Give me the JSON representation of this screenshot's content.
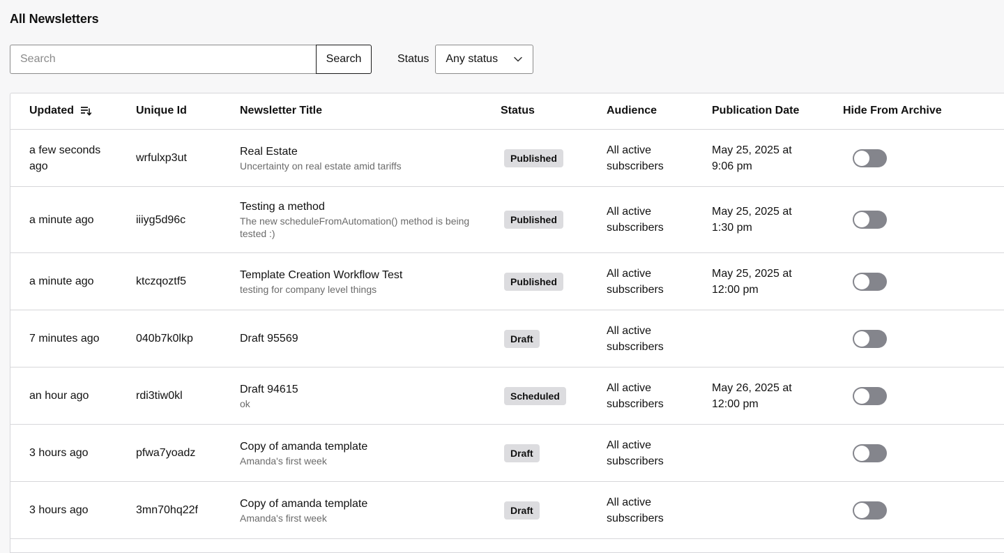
{
  "page": {
    "title": "All Newsletters"
  },
  "search": {
    "placeholder": "Search",
    "value": "",
    "button_label": "Search"
  },
  "status_filter": {
    "label": "Status",
    "selected": "Any status"
  },
  "table": {
    "columns": {
      "updated": "Updated",
      "unique_id": "Unique Id",
      "title": "Newsletter Title",
      "status": "Status",
      "audience": "Audience",
      "publication_date": "Publication Date",
      "hide_from_archive": "Hide From Archive"
    },
    "rows": [
      {
        "updated": "a few seconds ago",
        "unique_id": "wrfulxp3ut",
        "title": "Real Estate",
        "subtitle": "Uncertainty on real estate amid tariffs",
        "status": "Published",
        "audience": "All active subscribers",
        "publication_date": "May 25, 2025 at 9:06 pm",
        "hidden": false
      },
      {
        "updated": "a minute ago",
        "unique_id": "iiiyg5d96c",
        "title": "Testing a method",
        "subtitle": "The new scheduleFromAutomation() method is being tested :)",
        "status": "Published",
        "audience": "All active subscribers",
        "publication_date": "May 25, 2025 at 1:30 pm",
        "hidden": false
      },
      {
        "updated": "a minute ago",
        "unique_id": "ktczqoztf5",
        "title": "Template Creation Workflow Test",
        "subtitle": "testing for company level things",
        "status": "Published",
        "audience": "All active subscribers",
        "publication_date": "May 25, 2025 at 12:00 pm",
        "hidden": false
      },
      {
        "updated": "7 minutes ago",
        "unique_id": "040b7k0lkp",
        "title": "Draft 95569",
        "subtitle": "",
        "status": "Draft",
        "audience": "All active subscribers",
        "publication_date": "",
        "hidden": false
      },
      {
        "updated": "an hour ago",
        "unique_id": "rdi3tiw0kl",
        "title": "Draft 94615",
        "subtitle": "ok",
        "status": "Scheduled",
        "audience": "All active subscribers",
        "publication_date": "May 26, 2025 at 12:00 pm",
        "hidden": false
      },
      {
        "updated": "3 hours ago",
        "unique_id": "pfwa7yoadz",
        "title": "Copy of amanda template",
        "subtitle": "Amanda's first week",
        "status": "Draft",
        "audience": "All active subscribers",
        "publication_date": "",
        "hidden": false
      },
      {
        "updated": "3 hours ago",
        "unique_id": "3mn70hq22f",
        "title": "Copy of amanda template",
        "subtitle": "Amanda's first week",
        "status": "Draft",
        "audience": "All active subscribers",
        "publication_date": "",
        "hidden": false
      }
    ]
  },
  "icons": {
    "sort": "sort-descending-icon",
    "chevron": "chevron-down-icon"
  },
  "colors": {
    "badge_bg": "#dcdcdf",
    "toggle_off": "#84858c",
    "border": "#d7d7da"
  }
}
